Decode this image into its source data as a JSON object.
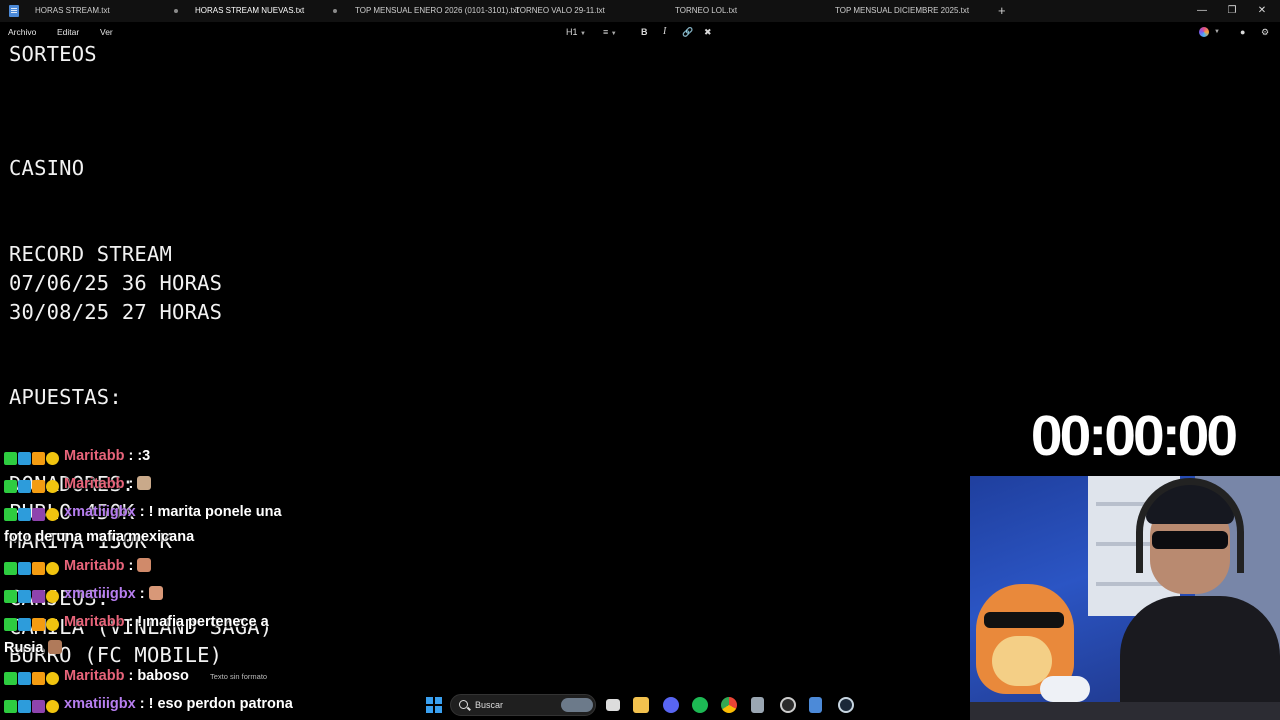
{
  "tabs": [
    {
      "label": "HORAS STREAM.txt",
      "active": false
    },
    {
      "label": "HORAS STREAM NUEVAS.txt",
      "active": true
    },
    {
      "label": "TOP MENSUAL ENERO 2026 (0101-3101).txt",
      "active": false
    },
    {
      "label": "TORNEO VALO 29-11.txt",
      "active": false
    },
    {
      "label": "TORNEO LOL.txt",
      "active": false
    },
    {
      "label": "TOP MENSUAL DICIEMBRE 2025.txt",
      "active": false
    }
  ],
  "new_tab": "+",
  "window_controls": {
    "minimize": "—",
    "maximize": "❐",
    "close": "✕"
  },
  "menu": {
    "file": "Archivo",
    "edit": "Editar",
    "view": "Ver"
  },
  "format_bar": {
    "heading": "H1",
    "bold": "B",
    "italic": "I"
  },
  "document": {
    "lines": [
      "SORTEOS",
      "CASINO",
      "RECORD STREAM",
      "07/06/25 36 HORAS",
      "30/08/25 27 HORAS",
      "APUESTAS:",
      "DONADORES:",
      "PUBLO 450K",
      "MARITA 150K K",
      "CANJEOS:",
      "CAMILA (VINLAND SAGA)",
      "BURRO (FC MOBILE)"
    ]
  },
  "timer": "00:00:00",
  "chat": {
    "colors": {
      "maritabb": "#e8647a",
      "xmatiiigbx": "#b77ef0"
    },
    "messages": [
      {
        "user": "Maritabb",
        "sep": " : ",
        "text": ":3"
      },
      {
        "user": "Maritabb",
        "sep": " : ",
        "text": ""
      },
      {
        "user": "xmatiiigbx",
        "sep": " : ",
        "text": "! marita ponele una"
      },
      {
        "user": "",
        "sep": "",
        "text": "foto de una mafia mexicana"
      },
      {
        "user": "Maritabb",
        "sep": " : ",
        "text": ""
      },
      {
        "user": "xmatiiigbx",
        "sep": " : ",
        "text": ""
      },
      {
        "user": "Maritabb",
        "sep": " : ",
        "text": "! mafia pertenece a"
      },
      {
        "user": "",
        "sep": "",
        "text": "Rusia"
      },
      {
        "user": "Maritabb",
        "sep": " : ",
        "text": "baboso"
      },
      {
        "user": "xmatiiigbx",
        "sep": " : ",
        "text": "! eso perdon patrona"
      }
    ]
  },
  "status_bar": "Texto sin formato",
  "taskbar": {
    "search_placeholder": "Buscar"
  }
}
